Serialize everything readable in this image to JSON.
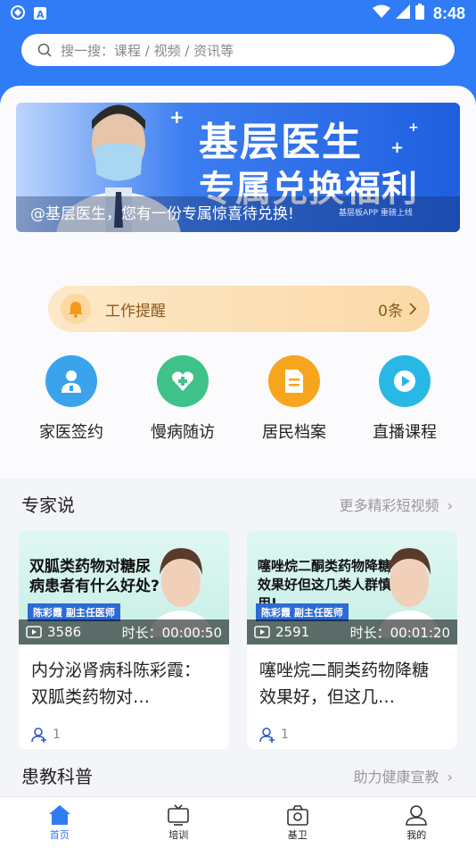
{
  "status_bar": {
    "time": "8:48"
  },
  "search": {
    "placeholder": "搜一搜：课程 / 视频 / 资讯等"
  },
  "banner": {
    "title_line1": "基层医生",
    "title_line2": "专属兑换福利",
    "caption": "@基层医生，您有一份专属惊喜待兑换!",
    "subtitle": "基层板APP 重磅上线"
  },
  "reminder": {
    "label": "工作提醒",
    "count": "0条"
  },
  "quick_actions": [
    {
      "label": "家医签约",
      "icon": "doctor-icon",
      "color": "#3aa3ec"
    },
    {
      "label": "慢病随访",
      "icon": "heart-care-icon",
      "color": "#3fc28a"
    },
    {
      "label": "居民档案",
      "icon": "document-icon",
      "color": "#f7a51d"
    },
    {
      "label": "直播课程",
      "icon": "play-icon",
      "color": "#29b7e5"
    }
  ],
  "expert_section": {
    "title": "专家说",
    "more": "更多精彩短视频"
  },
  "videos": [
    {
      "thumb_headline": "双胍类药物对糖尿病患者有什么好处?",
      "thumb_name": "陈彩霞   副主任医师",
      "views": "3586",
      "duration": "时长：00:00:50",
      "title": "内分泌肾病科陈彩霞：双胍类药物对…",
      "likes": "1"
    },
    {
      "thumb_headline": "噻唑烷二酮类药物降糖效果好但这几类人群慎用!",
      "thumb_name": "陈彩霞   副主任医师",
      "views": "2591",
      "duration": "时长：00:01:20",
      "title": "噻唑烷二酮类药物降糖效果好，但这几…",
      "likes": "1"
    }
  ],
  "education_section": {
    "title": "患教科普",
    "more": "助力健康宣教"
  },
  "tabs": [
    {
      "label": "首页",
      "icon": "home-icon",
      "active": true
    },
    {
      "label": "培训",
      "icon": "tv-icon",
      "active": false
    },
    {
      "label": "基卫",
      "icon": "clinic-icon",
      "active": false
    },
    {
      "label": "我的",
      "icon": "user-icon",
      "active": false
    }
  ],
  "colors": {
    "primary": "#2f7cf6",
    "reminder_text": "#8a5a1a"
  }
}
